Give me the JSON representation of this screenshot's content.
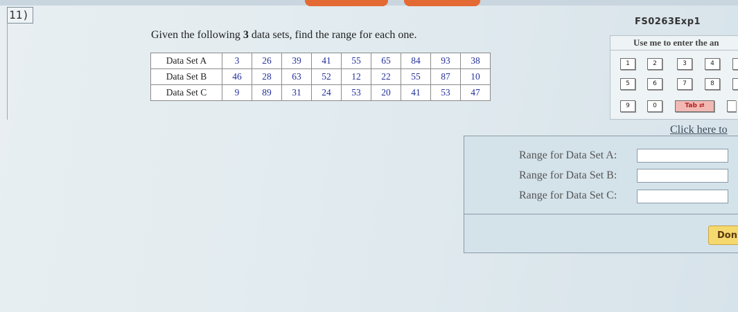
{
  "question": {
    "number": "11)",
    "prompt_before": "Given the following ",
    "prompt_bold": "3",
    "prompt_after": " data sets, find the range for each one."
  },
  "data_table": {
    "rows": [
      {
        "label": "Data Set A",
        "values": [
          "3",
          "26",
          "39",
          "41",
          "55",
          "65",
          "84",
          "93",
          "38"
        ]
      },
      {
        "label": "Data Set B",
        "values": [
          "46",
          "28",
          "63",
          "52",
          "12",
          "22",
          "55",
          "87",
          "10"
        ]
      },
      {
        "label": "Data Set C",
        "values": [
          "9",
          "89",
          "31",
          "24",
          "53",
          "20",
          "41",
          "53",
          "47"
        ]
      }
    ]
  },
  "keypad": {
    "code": "FS0263Exp1",
    "header": "Use me to enter the an",
    "keys": [
      "1",
      "2",
      "3",
      "4",
      "5",
      "6",
      "7",
      "8",
      "9",
      "0"
    ],
    "tab_label": "Tab ⇄"
  },
  "help_link": "Click here to",
  "answers": {
    "labels": [
      "Range for Data Set A:",
      "Range for Data Set B:",
      "Range for Data Set C:"
    ],
    "values": [
      "",
      "",
      ""
    ]
  },
  "done_label": "Don",
  "colors": {
    "value_text": "#23309a",
    "tab_key": "#f2b8b3",
    "done_button": "#f5d96e",
    "top_buttons": "#e46a34"
  }
}
